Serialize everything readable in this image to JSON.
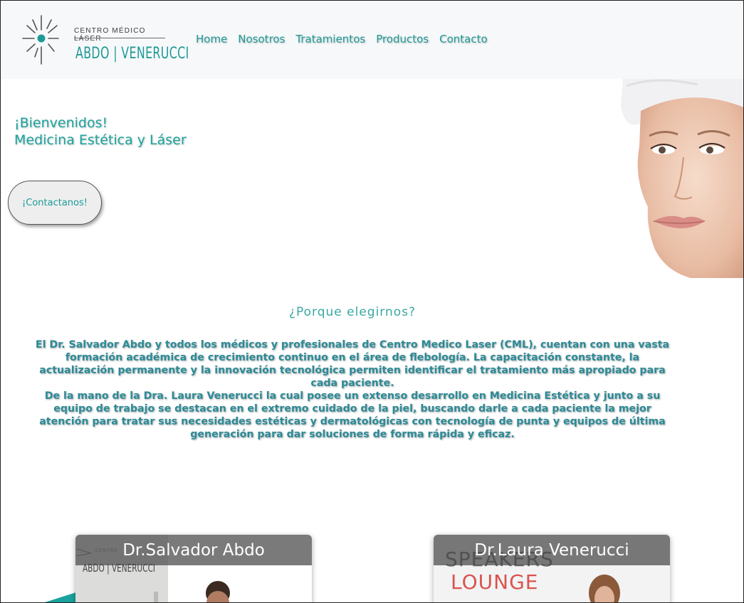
{
  "brand": {
    "top": "CENTRO MÉDICO LÁSER",
    "bottom": "ABDO | VENERUCCI",
    "accent": "#1d9a96"
  },
  "nav": {
    "items": [
      {
        "label": "Home"
      },
      {
        "label": "Nosotros"
      },
      {
        "label": "Tratamientos"
      },
      {
        "label": "Productos"
      },
      {
        "label": "Contacto"
      }
    ]
  },
  "hero": {
    "line1": "¡Bienvenidos!",
    "line2": "Medicina Estética y Láser",
    "button": "¡Contactanos!"
  },
  "why": {
    "title": "¿Porque elegirnos?",
    "para1": "El Dr. Salvador Abdo y todos los médicos y profesionales de Centro Medico Laser (CML), cuentan con una vasta formación académica de crecimiento continuo en el área de flebología. La capacitación constante, la actualización permanente y la innovación tecnológica permiten identificar el tratamiento más apropiado para cada paciente.",
    "para2": "De la mano de la Dra. Laura Venerucci la cual posee un extenso desarrollo en Medicina Estética y junto a su equipo de trabajo se destacan en el extremo cuidado de la piel, buscando darle a cada paciente la mejor atención para tratar sus necesidades estéticas y dermatológicas con tecnología de punta y equipos de última generación para dar soluciones de forma rápida y eficaz."
  },
  "doctors": [
    {
      "name": "Dr.Salvador Abdo",
      "photo_sign_top": "CENTRO",
      "photo_sign_bottom": "ABDO | VENERUCCI"
    },
    {
      "name": "Dr.Laura Venerucci",
      "photo_sign_top": "SPEAKERS",
      "photo_sign_bottom": "LOUNGE"
    }
  ]
}
